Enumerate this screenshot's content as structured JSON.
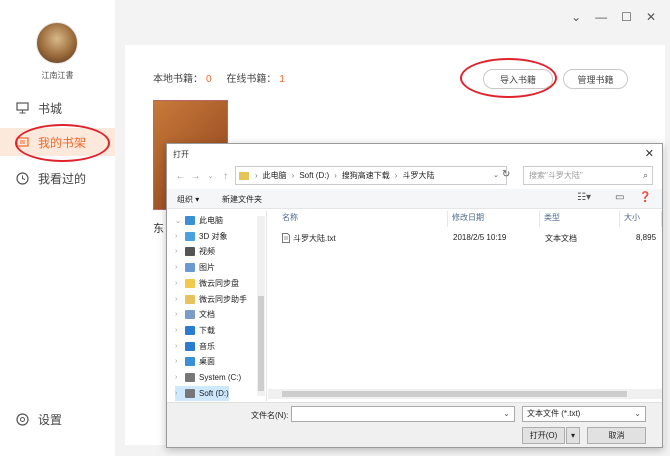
{
  "sidebar": {
    "username": "江南江書",
    "nav": [
      {
        "label": "书城",
        "icon": "monitor-icon"
      },
      {
        "label": "我的书架",
        "icon": "bookshelf-icon"
      },
      {
        "label": "我看过的",
        "icon": "clock-icon"
      }
    ],
    "settings_label": "设置"
  },
  "window": {
    "min": "⌄",
    "minimize": "—",
    "maximize": "☐",
    "close": "✕"
  },
  "shelf": {
    "local_label": "本地书籍：",
    "local_count": "0",
    "online_label": "在线书籍：",
    "online_count": "1",
    "import_button": "导入书籍",
    "manage_button": "管理书籍",
    "book_title_fragment": "东"
  },
  "dialog": {
    "title": "打开",
    "close": "✕",
    "path": [
      "此电脑",
      "Soft (D:)",
      "搜狗高速下载",
      "斗罗大陆"
    ],
    "search_placeholder": "搜索\"斗罗大陆\"",
    "organize": "组织 ▾",
    "new_folder": "新建文件夹",
    "tree": [
      {
        "label": "此电脑",
        "icon": "computer-icon",
        "color": "#3a8fd6"
      },
      {
        "label": "3D 对象",
        "icon": "cube-icon",
        "color": "#4aa0e0"
      },
      {
        "label": "视频",
        "icon": "video-icon",
        "color": "#555"
      },
      {
        "label": "图片",
        "icon": "picture-icon",
        "color": "#6a9ad0"
      },
      {
        "label": "微云同步盘",
        "icon": "folder-icon",
        "color": "#f2c94c"
      },
      {
        "label": "微云同步助手",
        "icon": "folder-icon",
        "color": "#e8c25a"
      },
      {
        "label": "文档",
        "icon": "document-icon",
        "color": "#7a9cc6"
      },
      {
        "label": "下载",
        "icon": "download-icon",
        "color": "#2b7bd0"
      },
      {
        "label": "音乐",
        "icon": "music-icon",
        "color": "#2b7bd0"
      },
      {
        "label": "桌面",
        "icon": "desktop-icon",
        "color": "#3a8fd6"
      },
      {
        "label": "System (C:)",
        "icon": "drive-icon",
        "color": "#777"
      },
      {
        "label": "Soft (D:)",
        "icon": "drive-icon",
        "color": "#777"
      }
    ],
    "columns": [
      "名称",
      "修改日期",
      "类型",
      "大小"
    ],
    "files": [
      {
        "name": "斗罗大陆.txt",
        "date": "2018/2/5 10:19",
        "type": "文本文档",
        "size": "8,895"
      }
    ],
    "filename_label": "文件名(N):",
    "filename_value": "",
    "filetype": "文本文件 (*.txt)",
    "open_button": "打开(O)",
    "cancel_button": "取消"
  },
  "colors": {
    "accent": "#ee6a2c",
    "annotation": "#e0232b"
  }
}
